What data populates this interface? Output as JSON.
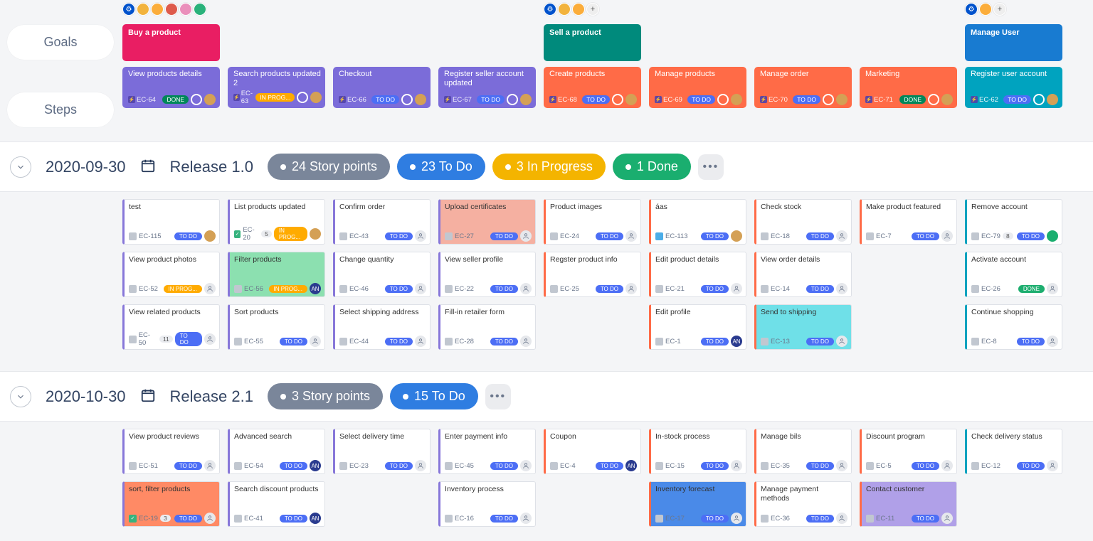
{
  "labels": {
    "goals": "Goals",
    "steps": "Steps"
  },
  "columns": [
    {
      "avatars": [
        "gear",
        "y",
        "o",
        "r",
        "p",
        "g"
      ],
      "goal": {
        "title": "Buy a product",
        "color": "#e91e63"
      },
      "step": {
        "title": "View products details",
        "key": "EC-64",
        "status": "DONE",
        "stepColor": "#7b6cd9"
      }
    },
    {
      "step": {
        "title": "Search products updated 2",
        "key": "EC-63",
        "status": "IN PROG...",
        "stepColor": "#7b6cd9"
      }
    },
    {
      "step": {
        "title": "Checkout",
        "key": "EC-66",
        "status": "TO DO",
        "stepColor": "#7b6cd9"
      }
    },
    {
      "step": {
        "title": "Register seller account updated",
        "key": "EC-67",
        "status": "TO DO",
        "stepColor": "#7b6cd9"
      }
    },
    {
      "avatars": [
        "gear",
        "y",
        "o",
        "plus"
      ],
      "goal": {
        "title": "Sell a product",
        "color": "#008a7c"
      },
      "step": {
        "title": "Create products",
        "key": "EC-68",
        "status": "TO DO",
        "stepColor": "#ff6b47"
      }
    },
    {
      "step": {
        "title": "Manage products",
        "key": "EC-69",
        "status": "TO DO",
        "stepColor": "#ff6b47"
      }
    },
    {
      "step": {
        "title": "Manage order",
        "key": "EC-70",
        "status": "TO DO",
        "stepColor": "#ff6b47"
      }
    },
    {
      "step": {
        "title": "Marketing",
        "key": "EC-71",
        "status": "DONE",
        "stepColor": "#ff6b47"
      }
    },
    {
      "avatars": [
        "gear",
        "o",
        "plus"
      ],
      "goal": {
        "title": "Manage User",
        "color": "#187bd1"
      },
      "step": {
        "title": "Register user account",
        "key": "EC-62",
        "status": "TO DO",
        "stepColor": "#00a3bf"
      }
    }
  ],
  "releases": [
    {
      "date": "2020-09-30",
      "name": "Release 1.0",
      "chips": [
        {
          "txt": "24 Story points",
          "cls": "c-gray"
        },
        {
          "txt": "23 To Do",
          "cls": "c-blue"
        },
        {
          "txt": "3 In Progress",
          "cls": "c-yel"
        },
        {
          "txt": "1 Done",
          "cls": "c-green"
        }
      ],
      "rows": [
        [
          {
            "title": "test",
            "key": "EC-115",
            "type": "t-task",
            "status": "TO DO",
            "stCls": "st-todo",
            "border": "#8777d9",
            "asImg": true
          },
          {
            "title": "List products updated",
            "key": "EC-20",
            "type": "t-story",
            "pts": "5",
            "status": "IN PROG...",
            "stCls": "st-prog",
            "border": "#8777d9",
            "asImg": true
          },
          {
            "title": "Confirm order",
            "key": "EC-43",
            "type": "t-task",
            "status": "TO DO",
            "stCls": "st-todo",
            "border": "#8777d9"
          },
          {
            "title": "Upload certificates",
            "key": "EC-27",
            "type": "t-task",
            "status": "TO DO",
            "stCls": "st-todo",
            "border": "#8777d9",
            "bg": "#f5b0a1"
          },
          {
            "title": "Product images",
            "key": "EC-24",
            "type": "t-task",
            "status": "TO DO",
            "stCls": "st-todo",
            "border": "#ff6b47"
          },
          {
            "title": "áas",
            "key": "EC-113",
            "type": "t-sub",
            "status": "TO DO",
            "stCls": "st-todo",
            "border": "#ff6b47",
            "asImg": true
          },
          {
            "title": "Check stock",
            "key": "EC-18",
            "type": "t-task",
            "status": "TO DO",
            "stCls": "st-todo",
            "border": "#ff6b47"
          },
          {
            "title": "Make product featured",
            "key": "EC-7",
            "type": "t-task",
            "status": "TO DO",
            "stCls": "st-todo",
            "border": "#ff6b47"
          },
          {
            "title": "Remove account",
            "key": "EC-79",
            "type": "t-task",
            "pts": "8",
            "status": "TO DO",
            "stCls": "st-todo",
            "border": "#00a3bf",
            "asGreen": true
          }
        ],
        [
          {
            "title": "View product photos",
            "key": "EC-52",
            "type": "t-task",
            "status": "IN PROG...",
            "stCls": "st-prog",
            "border": "#8777d9"
          },
          {
            "title": "Filter products",
            "key": "EC-56",
            "type": "t-task",
            "status": "IN PROG...",
            "stCls": "st-prog",
            "border": "#8777d9",
            "bg": "#8ce0b0",
            "asAN": true
          },
          {
            "title": "Change quantity",
            "key": "EC-46",
            "type": "t-task",
            "status": "TO DO",
            "stCls": "st-todo",
            "border": "#8777d9"
          },
          {
            "title": "View seller profile",
            "key": "EC-22",
            "type": "t-task",
            "status": "TO DO",
            "stCls": "st-todo",
            "border": "#8777d9"
          },
          {
            "title": "Regster product info",
            "key": "EC-25",
            "type": "t-task",
            "status": "TO DO",
            "stCls": "st-todo",
            "border": "#ff6b47"
          },
          {
            "title": "Edit product details",
            "key": "EC-21",
            "type": "t-task",
            "status": "TO DO",
            "stCls": "st-todo",
            "border": "#ff6b47"
          },
          {
            "title": "View order details",
            "key": "EC-14",
            "type": "t-task",
            "status": "TO DO",
            "stCls": "st-todo",
            "border": "#ff6b47"
          },
          null,
          {
            "title": "Activate account",
            "key": "EC-26",
            "type": "t-task",
            "status": "DONE",
            "stCls": "st-done",
            "border": "#00a3bf"
          }
        ],
        [
          {
            "title": "View related products",
            "key": "EC-50",
            "type": "t-task",
            "pts": "11",
            "status": "TO DO",
            "stCls": "st-todo",
            "border": "#8777d9"
          },
          {
            "title": "Sort products",
            "key": "EC-55",
            "type": "t-task",
            "status": "TO DO",
            "stCls": "st-todo",
            "border": "#8777d9"
          },
          {
            "title": "Select shipping address",
            "key": "EC-44",
            "type": "t-task",
            "status": "TO DO",
            "stCls": "st-todo",
            "border": "#8777d9"
          },
          {
            "title": "Fill-in retailer form",
            "key": "EC-28",
            "type": "t-task",
            "status": "TO DO",
            "stCls": "st-todo",
            "border": "#8777d9"
          },
          null,
          {
            "title": "Edit profile",
            "key": "EC-1",
            "type": "t-task",
            "status": "TO DO",
            "stCls": "st-todo",
            "border": "#ff6b47",
            "asAN": true
          },
          {
            "title": "Send to shipping",
            "key": "EC-13",
            "type": "t-task",
            "status": "TO DO",
            "stCls": "st-todo",
            "border": "#ff6b47",
            "bg": "#6fe0e8"
          },
          null,
          {
            "title": "Continue shopping",
            "key": "EC-8",
            "type": "t-task",
            "status": "TO DO",
            "stCls": "st-todo",
            "border": "#00a3bf"
          }
        ]
      ]
    },
    {
      "date": "2020-10-30",
      "name": "Release 2.1",
      "chips": [
        {
          "txt": "3 Story points",
          "cls": "c-gray"
        },
        {
          "txt": "15 To Do",
          "cls": "c-blue"
        }
      ],
      "rows": [
        [
          {
            "title": "View product reviews",
            "key": "EC-51",
            "type": "t-task",
            "status": "TO DO",
            "stCls": "st-todo",
            "border": "#8777d9"
          },
          {
            "title": "Advanced search",
            "key": "EC-54",
            "type": "t-task",
            "status": "TO DO",
            "stCls": "st-todo",
            "border": "#8777d9",
            "asAN": true
          },
          {
            "title": "Select delivery time",
            "key": "EC-23",
            "type": "t-task",
            "status": "TO DO",
            "stCls": "st-todo",
            "border": "#8777d9"
          },
          {
            "title": "Enter payment info",
            "key": "EC-45",
            "type": "t-task",
            "status": "TO DO",
            "stCls": "st-todo",
            "border": "#8777d9"
          },
          {
            "title": "Coupon",
            "key": "EC-4",
            "type": "t-task",
            "status": "TO DO",
            "stCls": "st-todo",
            "border": "#ff6b47",
            "asAN": true
          },
          {
            "title": "In-stock process",
            "key": "EC-15",
            "type": "t-task",
            "status": "TO DO",
            "stCls": "st-todo",
            "border": "#ff6b47"
          },
          {
            "title": "Manage bils",
            "key": "EC-35",
            "type": "t-task",
            "status": "TO DO",
            "stCls": "st-todo",
            "border": "#ff6b47"
          },
          {
            "title": "Discount program",
            "key": "EC-5",
            "type": "t-task",
            "status": "TO DO",
            "stCls": "st-todo",
            "border": "#ff6b47"
          },
          {
            "title": "Check delivery status",
            "key": "EC-12",
            "type": "t-task",
            "status": "TO DO",
            "stCls": "st-todo",
            "border": "#00a3bf"
          }
        ],
        [
          {
            "title": "sort, filter products",
            "key": "EC-19",
            "type": "t-story",
            "pts": "3",
            "status": "TO DO",
            "stCls": "st-todo",
            "border": "#8777d9",
            "bg": "#ff8a65"
          },
          {
            "title": "Search discount products",
            "key": "EC-41",
            "type": "t-task",
            "status": "TO DO",
            "stCls": "st-todo",
            "border": "#8777d9",
            "asAN": true
          },
          null,
          {
            "title": "Inventory process",
            "key": "EC-16",
            "type": "t-task",
            "status": "TO DO",
            "stCls": "st-todo",
            "border": "#8777d9"
          },
          null,
          {
            "title": "Inventory forecast",
            "key": "EC-17",
            "type": "t-task",
            "status": "TO DO",
            "stCls": "st-todo",
            "border": "#ff6b47",
            "bg": "#4a8ae8"
          },
          {
            "title": "Manage payment methods",
            "key": "EC-36",
            "type": "t-task",
            "status": "TO DO",
            "stCls": "st-todo",
            "border": "#ff6b47"
          },
          {
            "title": "Contact customer",
            "key": "EC-11",
            "type": "t-task",
            "status": "TO DO",
            "stCls": "st-todo",
            "border": "#ff6b47",
            "bg": "#b0a0e8"
          },
          null
        ]
      ]
    }
  ]
}
